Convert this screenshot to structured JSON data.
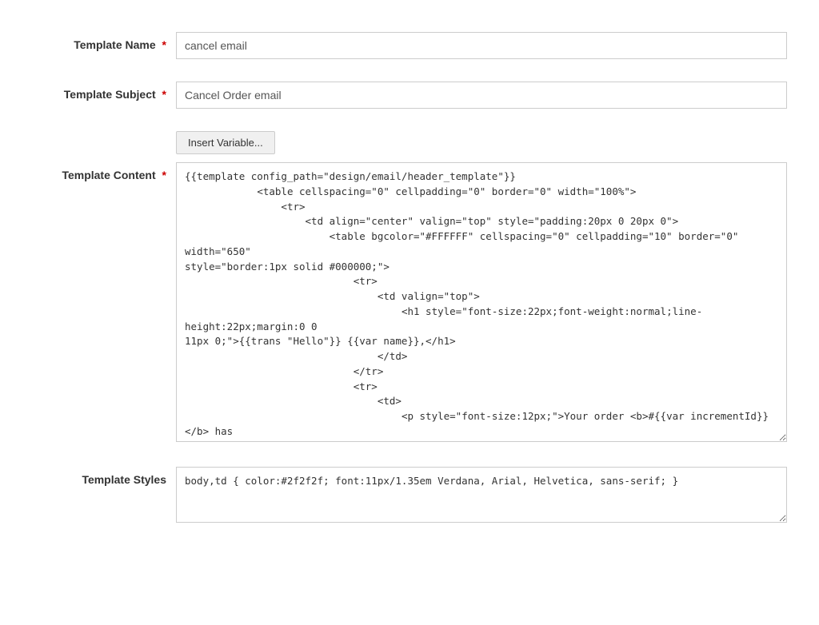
{
  "form": {
    "template_name": {
      "label": "Template Name",
      "value": "cancel email",
      "required": true
    },
    "template_subject": {
      "label": "Template Subject",
      "value": "Cancel Order email",
      "required": true
    },
    "insert_variable_btn": "Insert Variable...",
    "template_content": {
      "label": "Template Content",
      "required": true,
      "value": "{{template config_path=\"design/email/header_template\"}}\n            <table cellspacing=\"0\" cellpadding=\"0\" border=\"0\" width=\"100%\">\n                <tr>\n                    <td align=\"center\" valign=\"top\" style=\"padding:20px 0 20px 0\">\n                        <table bgcolor=\"#FFFFFF\" cellspacing=\"0\" cellpadding=\"10\" border=\"0\" width=\"650\"\nstyle=\"border:1px solid #000000;\">\n                            <tr>\n                                <td valign=\"top\">\n                                    <h1 style=\"font-size:22px;font-weight:normal;line-height:22px;margin:0 0\n11px 0;\">{{trans \"Hello\"}} {{var name}},</h1>\n                                </td>\n                            </tr>\n                            <tr>\n                                <td>\n                                    <p style=\"font-size:12px;\">Your order <b>#{{var incrementId}}</b> has\nbeen cancelled. {{trans 'You can check the status of your order by\n                        <a href=\"%account_url\">logging into your\naccount</a>.' account_url=$this.getUrl($store,'customer/account/',[_nosid:1]) |raw}}</p>\n                                    <p style=\"font-size:12px;\">{{trans \"Please review accordingly. Details are\nas below.\"}}</p>"
    },
    "template_styles": {
      "label": "Template Styles",
      "value": "body,td { color:#2f2f2f; font:11px/1.35em Verdana, Arial, Helvetica, sans-serif; }"
    }
  }
}
